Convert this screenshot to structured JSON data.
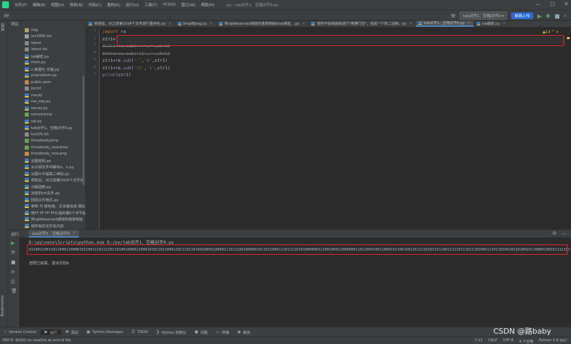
{
  "window": {
    "project_short": "py",
    "title": "py - tab对齐1、空格对齐0.py",
    "menu": [
      "文件(F)",
      "编辑(E)",
      "视图(V)",
      "导航(N)",
      "代码(C)",
      "重构(R)",
      "运行(U)",
      "工具(T)",
      "VCS(S)",
      "窗口(W)",
      "帮助(H)"
    ],
    "controls": [
      "—",
      "□",
      "✕"
    ]
  },
  "navbar": {
    "project": "py",
    "run_config": "tab对齐1、空格对齐0",
    "upload_button": "极简上传"
  },
  "left_strip": {
    "project": "项目",
    "bookmarks": "Bookmarks",
    "structure": "结构"
  },
  "project_panel": {
    "title": "项目",
    "files": [
      {
        "name": "nag",
        "type": "folder"
      },
      {
        "name": "iso1995.iso",
        "type": "iso"
      },
      {
        "name": "latest",
        "type": "txt"
      },
      {
        "name": "latest.txt",
        "type": "txt"
      },
      {
        "name": "lsb解密.py",
        "type": "py"
      },
      {
        "name": "main.py",
        "type": "py"
      },
      {
        "name": "n 数据为 交错.py",
        "type": "py"
      },
      {
        "name": "picproblem.py",
        "type": "py"
      },
      {
        "name": "public.pem",
        "type": "pem"
      },
      {
        "name": "py.txt",
        "type": "txt"
      },
      {
        "name": "rsa.py",
        "type": "py"
      },
      {
        "name": "rsa_exp.py",
        "type": "py"
      },
      {
        "name": "server.py",
        "type": "py"
      },
      {
        "name": "solved.bmp",
        "type": "bmp"
      },
      {
        "name": "sql.py",
        "type": "py"
      },
      {
        "name": "tab对齐1、空格对齐0.py",
        "type": "py"
      },
      {
        "name": "test16.txt",
        "type": "txt"
      },
      {
        "name": "threebody.bmp",
        "type": "bmp"
      },
      {
        "name": "threebody_new.bmp",
        "type": "bmp"
      },
      {
        "name": "threebody_new.png",
        "type": "png"
      },
      {
        "name": "云图密码.py",
        "type": "py"
      },
      {
        "name": "从公钥文件中解出n、e.py",
        "type": "py"
      },
      {
        "name": "从图片中提取二维码.py",
        "type": "py"
      },
      {
        "name": "将前后、对之前第1024个文件进",
        "type": "py"
      },
      {
        "name": "分解函数.py",
        "type": "py"
      },
      {
        "name": "加密的txt文件.py",
        "type": "py"
      },
      {
        "name": "回顾文件格式.py",
        "type": "py"
      },
      {
        "name": "审核 与 颜色值、文本输出来 做比",
        "type": "py"
      },
      {
        "name": "按FF FF FF FF比值的第5个字节提",
        "type": "py"
      },
      {
        "name": "将rgbReserved通道的值复制给",
        "type": "py"
      },
      {
        "name": "将所有的文件名内容",
        "type": "py"
      }
    ]
  },
  "editor_tabs": [
    {
      "label": "将前后、对之前第1024个文件进行重命名.py",
      "active": false
    },
    {
      "label": "bmp转png.py",
      "active": false
    },
    {
      "label": "将rgbReserved通道的值复制给blue通道。.py",
      "active": false
    },
    {
      "label": "按将不拍挡曲线进行\"摩擦打击\"，完成一个的二进制。py",
      "active": false
    },
    {
      "label": "tab对齐1、空格对齐0.py",
      "active": true
    },
    {
      "label": "lsb解密.py",
      "active": false
    }
  ],
  "editor": {
    "line_numbers": [
      "1",
      "2",
      "3",
      "4",
      "5",
      "6",
      "7"
    ],
    "warnings": "▲13 ^ ∨",
    "code": {
      "l1_kw": "import",
      "l1_rest": " re",
      "l2": "str1=",
      "l3": "#str1=re.sub('  ','',str1)",
      "l4": "#str1=re.sub('\\[','',str1)",
      "l5_a": "str1=re.",
      "l5_fn": "sub",
      "l5_b": "(",
      "l5_s1": "' '",
      "l5_c": ",",
      "l5_s2": "'0'",
      "l5_d": ",str1)",
      "l6_a": "str1=re.",
      "l6_fn": "sub",
      "l6_b": "(",
      "l6_s1": "'\\t'",
      "l6_c": ",",
      "l6_s2": "'1'",
      "l6_d": ",str1)",
      "l7_fn": "print",
      "l7_rest": "(str1)"
    }
  },
  "run_panel": {
    "label": "运行:",
    "tab": "tab对齐1、空格对齐0",
    "command": "D:\\py\\venv\\Scripts\\python.exe D:/py/tab对齐1、空格对齐0.py",
    "output": "0110011001101100011000010110011101111011010010000110001010110110001101110110100100011000011101110010000010110110001110111101010000001110010001100000011011000100110001011001001101111010110110011111011101110100011101101001011010010110000100101111101",
    "exit_message": "进程已结束，退出代码0"
  },
  "tool_bar": [
    {
      "label": "Version Control",
      "icon": "branch-icon"
    },
    {
      "label": "运行",
      "icon": "play-icon"
    },
    {
      "label": "调试",
      "icon": "bug-icon"
    },
    {
      "label": "Python Packages",
      "icon": "package-icon"
    },
    {
      "label": "TODO",
      "icon": "list-icon"
    },
    {
      "label": "Python 控制台",
      "icon": "console-icon"
    },
    {
      "label": "问题",
      "icon": "problems-icon"
    },
    {
      "label": "终端",
      "icon": "terminal-icon"
    },
    {
      "label": "服务",
      "icon": "services-icon"
    }
  ],
  "status_bar": {
    "message": "PEP 8: W292 no newline at end of file",
    "position": "7:12",
    "line_sep": "CRLF",
    "encoding": "UTF-8",
    "indent": "4 个空格",
    "interpreter": "Python 3.9 (py)"
  },
  "watermark": "CSDN @路baby",
  "colors": {
    "highlight_box": "#e8262b",
    "keyword": "#cc7832",
    "string": "#6a8759",
    "builtin": "#8888c6"
  }
}
